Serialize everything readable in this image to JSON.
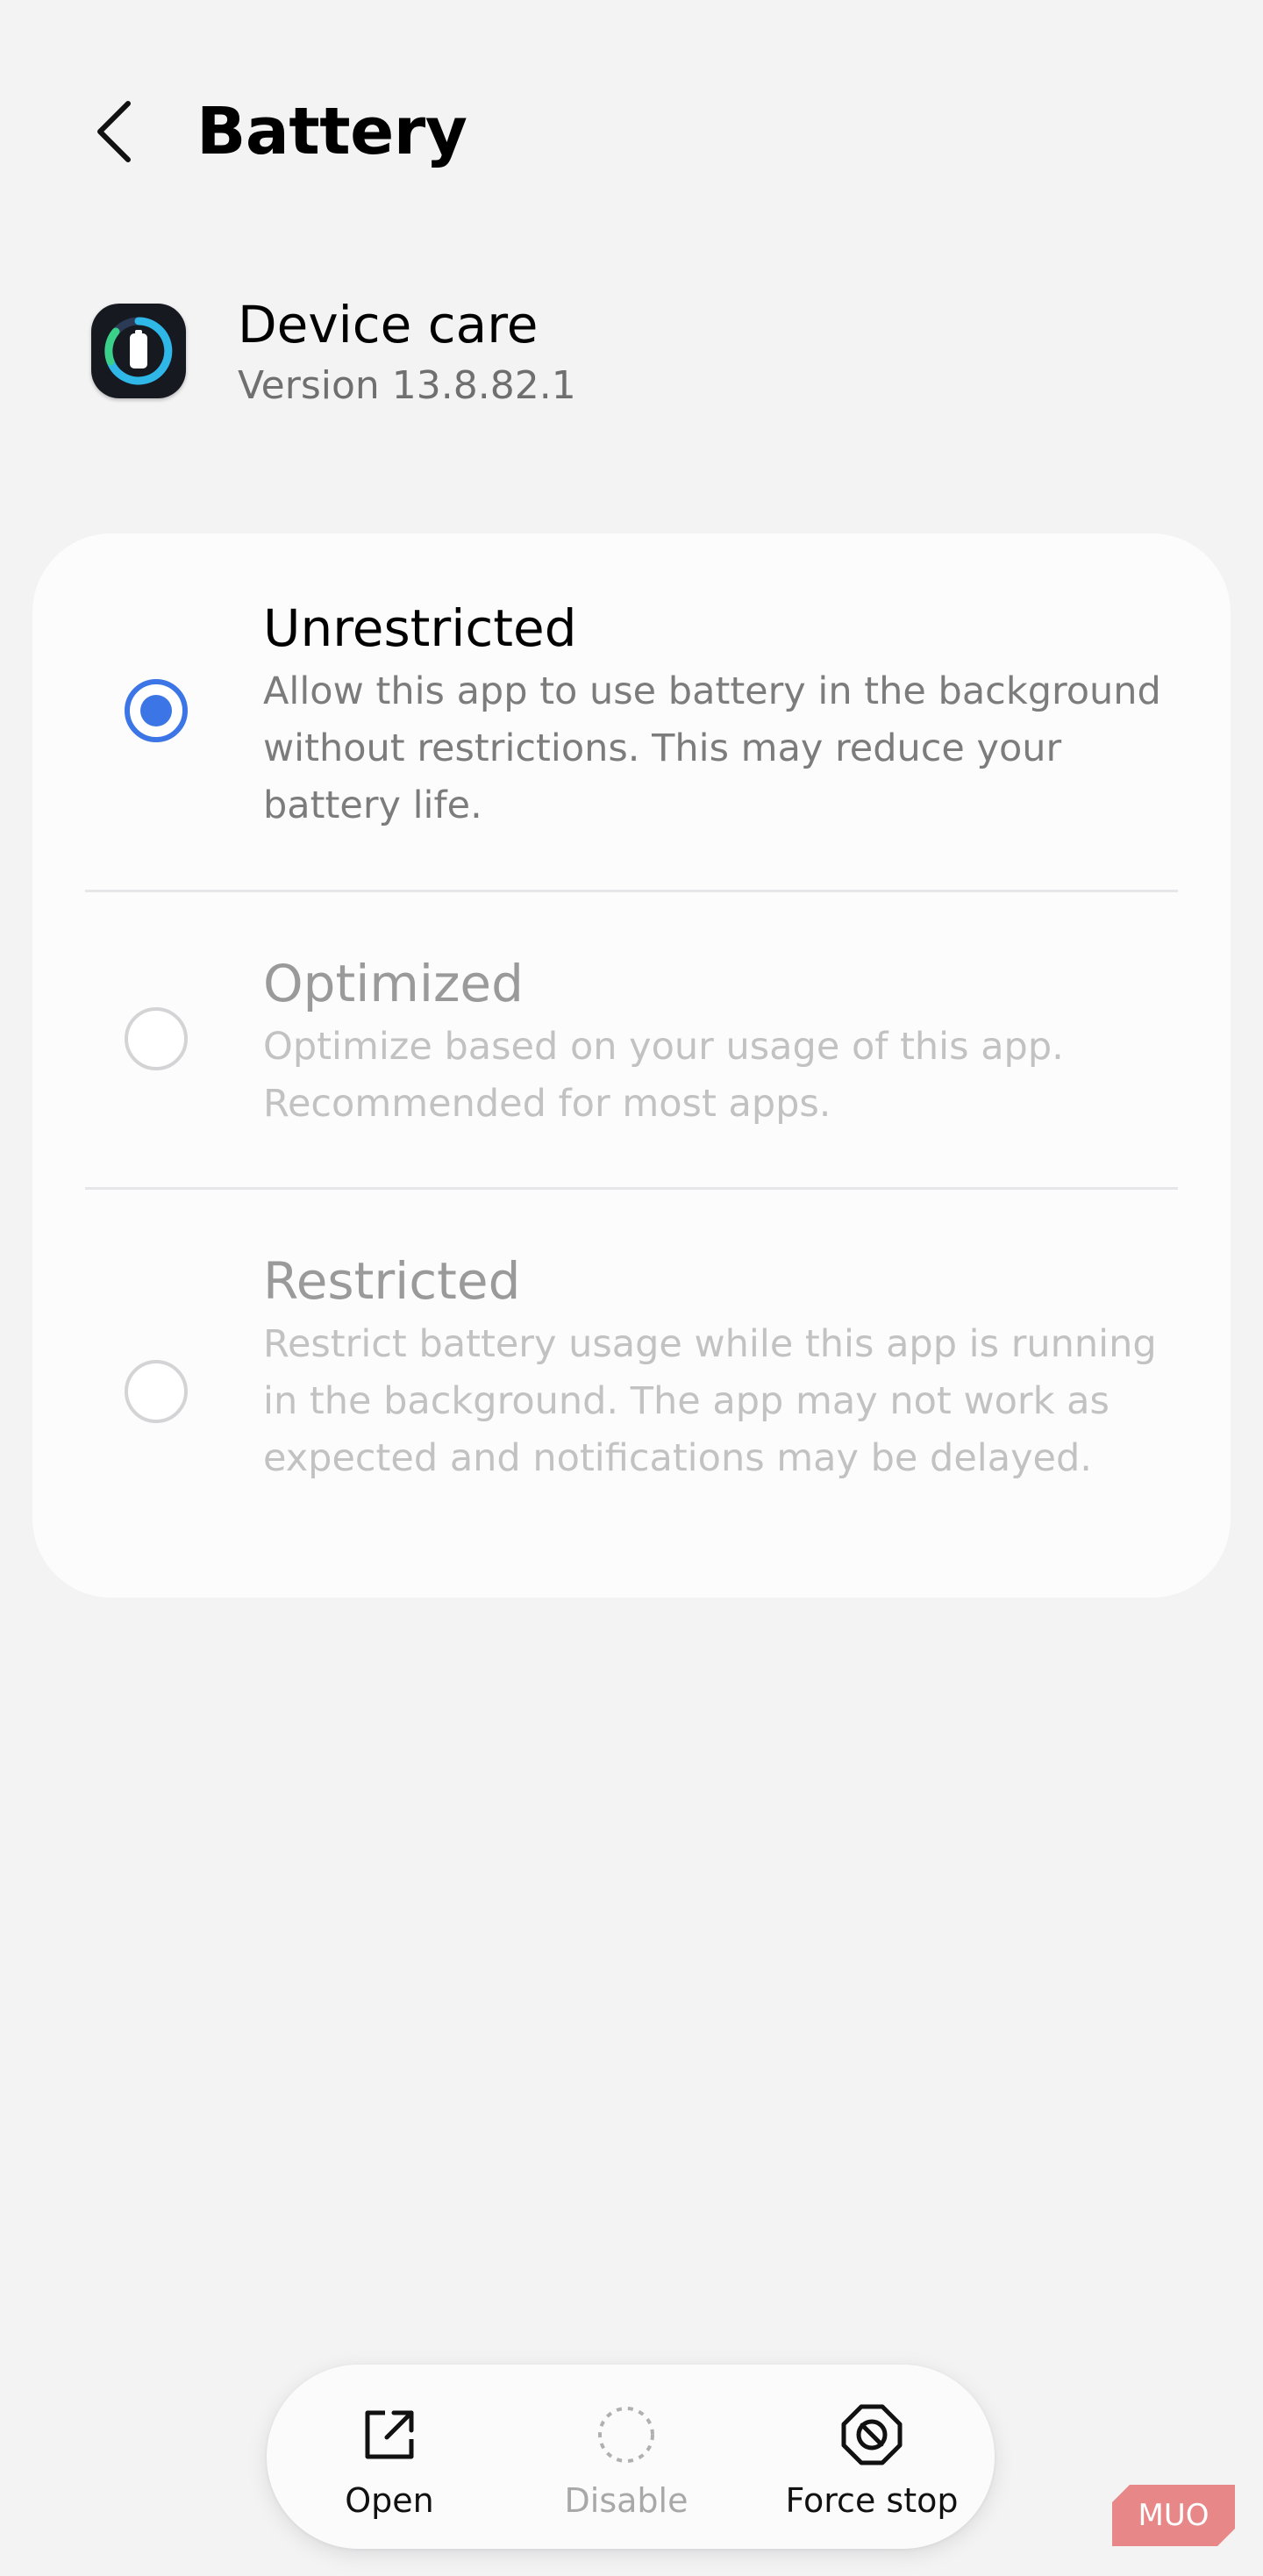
{
  "header": {
    "title": "Battery",
    "back_icon": "chevron-left-icon"
  },
  "app": {
    "name": "Device care",
    "version": "Version 13.8.82.1",
    "icon": "device-care-icon"
  },
  "battery_options": [
    {
      "title": "Unrestricted",
      "description": "Allow this app to use battery in the background without restrictions. This may reduce your battery life.",
      "selected": true,
      "enabled": true
    },
    {
      "title": "Optimized",
      "description": "Optimize based on your usage of this app. Recommended for most apps.",
      "selected": false,
      "enabled": false
    },
    {
      "title": "Restricted",
      "description": "Restrict battery usage while this app is running in the background. The app may not work as expected and notifications may be delayed.",
      "selected": false,
      "enabled": false
    }
  ],
  "bottom_bar": {
    "open_label": "Open",
    "disable_label": "Disable",
    "force_stop_label": "Force stop"
  },
  "colors": {
    "accent": "#3c75e6",
    "background": "#f3f3f4",
    "card": "#fcfcfc"
  },
  "watermark": {
    "text": "MUO",
    "color": "#e57373"
  }
}
